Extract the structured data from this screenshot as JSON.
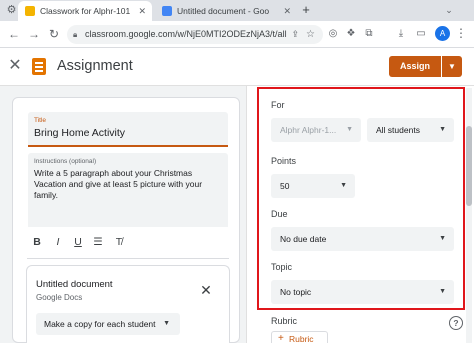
{
  "browser": {
    "tabs": [
      {
        "title": "Classwork for Alphr-101",
        "active": true
      },
      {
        "title": "Untitled document - Google Do",
        "active": false
      }
    ],
    "new_tab": "+",
    "url": "classroom.google.com/w/NjE0MTI2ODEzNjA3/t/all"
  },
  "header": {
    "title": "Assignment",
    "assign_label": "Assign"
  },
  "form": {
    "title_label": "Title",
    "title_value": "Bring Home Activity",
    "instructions_label": "Instructions (optional)",
    "instructions_value": "Write a 5 paragraph about your Christmas Vacation and give at least 5 picture with your family.",
    "format_buttons": [
      "B",
      "I",
      "U",
      "☰",
      "T̸"
    ]
  },
  "attachment": {
    "title": "Untitled document",
    "subtitle": "Google Docs",
    "copy_option": "Make a copy for each student"
  },
  "sidebar": {
    "for_label": "For",
    "class_value": "Alphr Alphr-1...",
    "students_value": "All students",
    "points_label": "Points",
    "points_value": "50",
    "due_label": "Due",
    "due_value": "No due date",
    "topic_label": "Topic",
    "topic_value": "No topic",
    "rubric_label": "Rubric",
    "rubric_button": "Rubric"
  },
  "colors": {
    "accent": "#c65911",
    "highlight_border": "#e0161b"
  },
  "icons": [
    "settings-icon",
    "back-icon",
    "forward-icon",
    "reload-icon",
    "lock-icon",
    "share-icon",
    "star-icon",
    "extensions-icon",
    "download-icon",
    "close-icon",
    "assignment-icon",
    "help-icon"
  ]
}
